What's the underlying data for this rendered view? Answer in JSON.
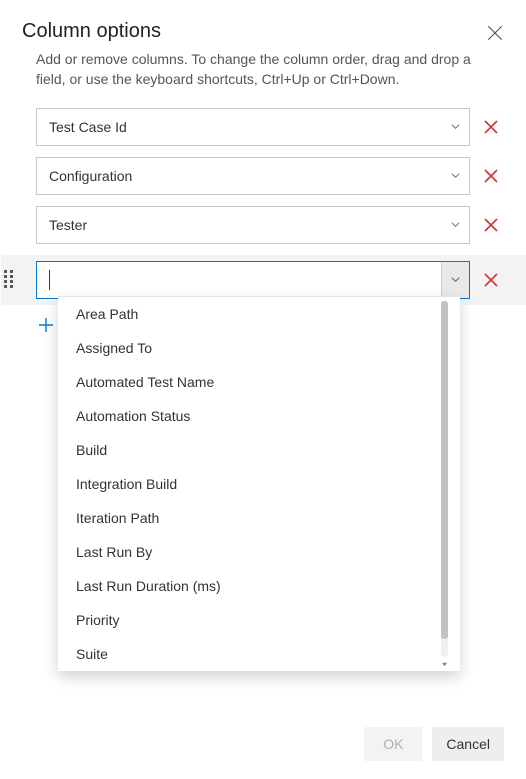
{
  "header": {
    "title": "Column options",
    "description": "Add or remove columns. To change the column order, drag and drop a field, or use the keyboard shortcuts, Ctrl+Up or Ctrl+Down."
  },
  "columns": [
    {
      "value": "Test Case Id"
    },
    {
      "value": "Configuration"
    },
    {
      "value": "Tester"
    }
  ],
  "active_input": {
    "value": ""
  },
  "dropdown_options": [
    "Area Path",
    "Assigned To",
    "Automated Test Name",
    "Automation Status",
    "Build",
    "Integration Build",
    "Iteration Path",
    "Last Run By",
    "Last Run Duration (ms)",
    "Priority",
    "Suite"
  ],
  "footer": {
    "ok_label": "OK",
    "cancel_label": "Cancel"
  }
}
